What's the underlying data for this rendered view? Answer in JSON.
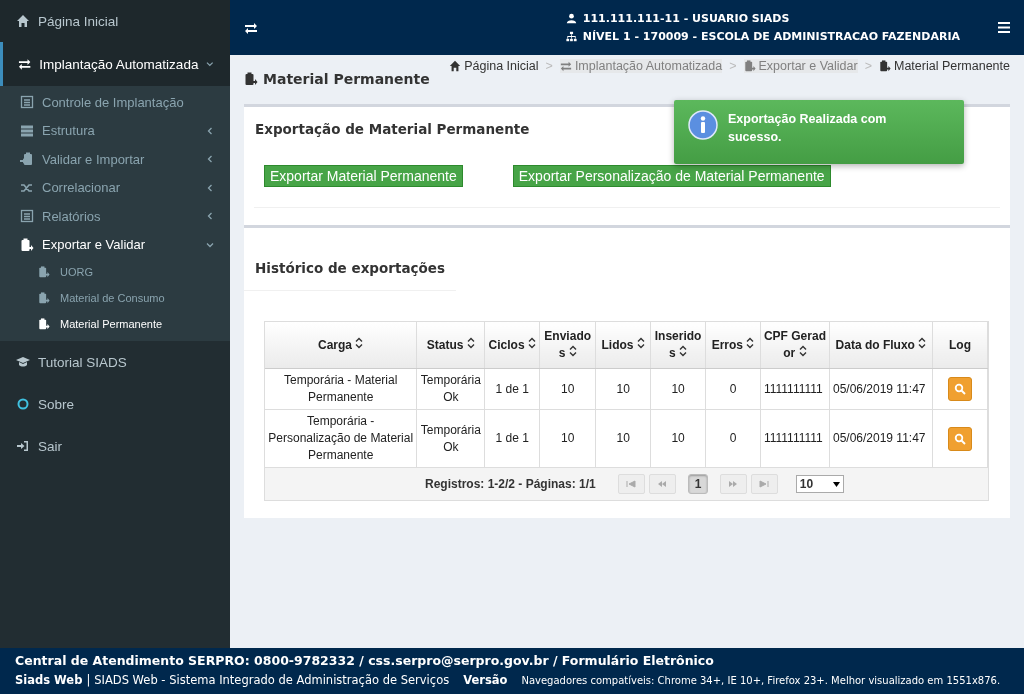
{
  "sidebar": {
    "items": [
      {
        "label": "Página Inicial",
        "selected": false
      },
      {
        "label": "Implantação Automatizada",
        "selected": true,
        "expanded": true,
        "children": [
          {
            "label": "Controle de Implantação",
            "selected": false
          },
          {
            "label": "Estrutura",
            "selected": false,
            "expanded": false
          },
          {
            "label": "Validar e Importar",
            "selected": false,
            "expanded": false
          },
          {
            "label": "Correlacionar",
            "selected": false,
            "expanded": false
          },
          {
            "label": "Relatórios",
            "selected": false,
            "expanded": false
          },
          {
            "label": "Exportar e Validar",
            "selected": true,
            "expanded": true,
            "children": [
              {
                "label": "UORG",
                "selected": false
              },
              {
                "label": "Material de Consumo",
                "selected": false
              },
              {
                "label": "Material Permanente",
                "selected": true
              }
            ]
          }
        ]
      },
      {
        "label": "Tutorial SIADS",
        "selected": false
      },
      {
        "label": "Sobre",
        "selected": false
      },
      {
        "label": "Sair",
        "selected": false
      }
    ]
  },
  "header": {
    "user": "111.111.111-11 - USUARIO SIADS",
    "level": "NÍVEL 1 - 170009 - ESCOLA DE ADMINISTRACAO FAZENDARIA"
  },
  "breadcrumb": [
    {
      "label": "Página Inicial",
      "disabled": false
    },
    {
      "label": "Implantação Automatizada",
      "disabled": true
    },
    {
      "label": "Exportar e Validar",
      "disabled": true
    },
    {
      "label": "Material Permanente",
      "disabled": false
    }
  ],
  "breadcrumb_separator": ">",
  "page_title": "Material Permanente",
  "export_panel": {
    "title": "Exportação de Material Permanente",
    "buttons": [
      "Exportar Material Permanente",
      "Exportar Personalização de Material Permanente"
    ]
  },
  "toast": {
    "message": "Exportação Realizada com sucesso."
  },
  "history_panel": {
    "title": "Histórico de exportações",
    "table": {
      "columns": [
        {
          "label": "Carga",
          "sortable": true
        },
        {
          "label": "Status",
          "sortable": true
        },
        {
          "label": "Ciclos",
          "sortable": true
        },
        {
          "label": "Enviados",
          "sortable": true
        },
        {
          "label": "Lidos",
          "sortable": true
        },
        {
          "label": "Inseridos",
          "sortable": true
        },
        {
          "label": "Erros",
          "sortable": true
        },
        {
          "label": "CPF Gerador",
          "sortable": true
        },
        {
          "label": "Data do Fluxo",
          "sortable": true
        },
        {
          "label": "Log",
          "sortable": false
        }
      ],
      "rows": [
        [
          "Temporária - Material Permanente",
          "Temporária Ok",
          "1 de 1",
          "10",
          "10",
          "10",
          "0",
          "1111111111",
          "05/06/2019 11:47"
        ],
        [
          "Temporária - Personalização de Material Permanente",
          "Temporária Ok",
          "1 de 1",
          "10",
          "10",
          "10",
          "0",
          "1111111111",
          "05/06/2019 11:47"
        ]
      ]
    },
    "pager": {
      "summary": "Registros: 1-2/2 - Páginas: 1/1",
      "pages": [
        {
          "label": "1",
          "selected": true
        }
      ],
      "page_size": "10"
    }
  },
  "footer": {
    "contact": "Central de Atendimento SERPRO: 0800-9782332 / css.serpro@serpro.gov.br / Formulário Eletrônico",
    "brand": "Siads Web",
    "separator": "|",
    "system": "SIADS Web - Sistema Integrado de Administração de Serviços",
    "version": "Versão",
    "browsers": "Navegadores compatíveis: Chrome 34+, IE 10+, Firefox 23+. Melhor visualizado em 1551x876."
  }
}
